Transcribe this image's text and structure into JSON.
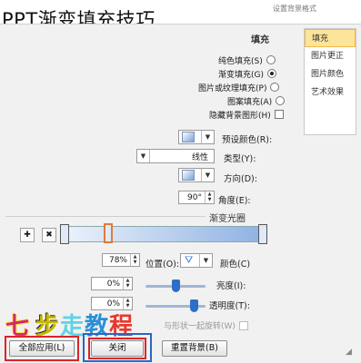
{
  "page_title": "PPT渐变填充技巧",
  "window_caption": "设置背景格式",
  "sidebar": {
    "items": [
      {
        "label": "填充",
        "active": true
      },
      {
        "label": "图片更正",
        "active": false
      },
      {
        "label": "图片颜色",
        "active": false
      },
      {
        "label": "艺术效果",
        "active": false
      }
    ]
  },
  "fill": {
    "section_label": "填充",
    "options": [
      {
        "label": "纯色填充(S)",
        "checked": false
      },
      {
        "label": "渐变填充(G)",
        "checked": true
      },
      {
        "label": "图片或纹理填充(P)",
        "checked": false
      },
      {
        "label": "图案填充(A)",
        "checked": false
      }
    ],
    "hide_bg_graphics_label": "隐藏背景图形(H)"
  },
  "preset_colors_label": "预设颜色(R):",
  "type_label": "类型(Y):",
  "type_value": "线性",
  "direction_label": "方向(D):",
  "angle_label": "角度(E):",
  "angle_value": "90°",
  "gradient_stops_label": "渐变光圈",
  "color_label": "颜色(C)",
  "position_label": "位置(O):",
  "position_value": "78%",
  "brightness_label": "亮度(I):",
  "brightness_value": "0%",
  "brightness_level": 0.5,
  "transparency_label": "透明度(T):",
  "transparency_value": "0%",
  "transparency_level": 0.8,
  "rotate_with_shape_label": "与形状一起旋转(W)",
  "watermark_text": [
    "七",
    "步",
    "走",
    "教",
    "程"
  ],
  "buttons": {
    "apply_all": "全部应用(L)",
    "close": "关闭",
    "reset": "重置背景(B)"
  },
  "colors": {
    "active_tab_bg": "#fde49b",
    "highlight_red": "#d9252a",
    "highlight_blue": "#2a67c4",
    "selected_stop": "#e07a3a"
  }
}
